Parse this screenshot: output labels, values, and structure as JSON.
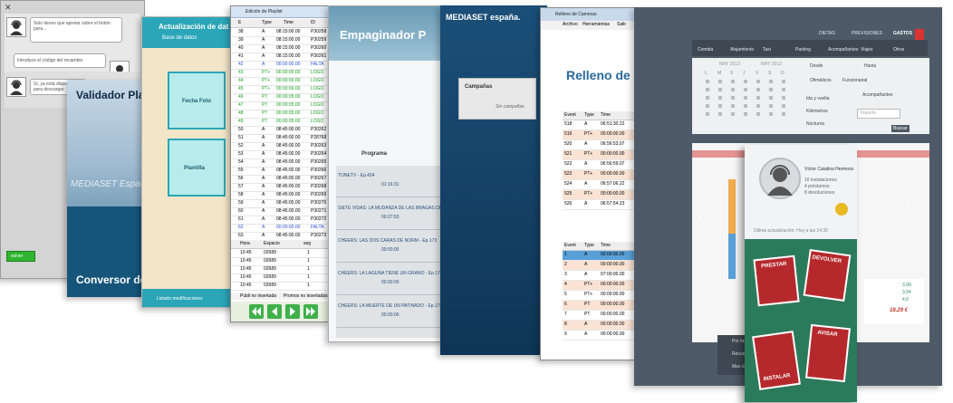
{
  "card1": {
    "close": "✕",
    "bubble1": "Solo tienes que apretar sobre el botón para...",
    "bubble2": "Introduce el código del recambio",
    "bubble3": "Sí, ya está disponible para descargar",
    "button": "volver"
  },
  "card2": {
    "title": "Validador Pla",
    "brand": "MEDIASET España",
    "footer": "Conversor de"
  },
  "card3": {
    "title": "Actualización de dat",
    "subtitle": "Base de datos",
    "tile1": "Fecha Foto",
    "tile2": "Plantilla",
    "footer": "Listado modificaciones"
  },
  "card4": {
    "window_title": "Edición de Playlist",
    "columns": [
      "E",
      "Type",
      "Time",
      "ID"
    ],
    "rows": [
      {
        "n": "38",
        "t": "A",
        "time": "08:15:00.00",
        "id": "P30258",
        "c": "#000000"
      },
      {
        "n": "39",
        "t": "A",
        "time": "08:15:00.00",
        "id": "P30259",
        "c": "#000000"
      },
      {
        "n": "40",
        "t": "A",
        "time": "08:15:00.00",
        "id": "P30260",
        "c": "#000000"
      },
      {
        "n": "41",
        "t": "A",
        "time": "08:15:00.00",
        "id": "P30261",
        "c": "#000000"
      },
      {
        "n": "42",
        "t": "A",
        "time": "00:00:00.00",
        "id": "FALTA",
        "c": "#2a4fd6"
      },
      {
        "n": "43",
        "t": "PT+",
        "time": "00:00:00.00",
        "id": "LOGO",
        "c": "#19a020"
      },
      {
        "n": "44",
        "t": "PT+",
        "time": "00:00:00.00",
        "id": "LOGO",
        "c": "#19a020"
      },
      {
        "n": "45",
        "t": "PT+",
        "time": "00:00:00.00",
        "id": "LOGO",
        "c": "#19a020"
      },
      {
        "n": "46",
        "t": "PT",
        "time": "00:00:05.00",
        "id": "LOGO",
        "c": "#19a020"
      },
      {
        "n": "47",
        "t": "PT",
        "time": "00:00:05.00",
        "id": "LOGO",
        "c": "#19a020"
      },
      {
        "n": "48",
        "t": "PT",
        "time": "00:00:05.00",
        "id": "LOGO",
        "c": "#19a020"
      },
      {
        "n": "49",
        "t": "PT",
        "time": "00:00:05.00",
        "id": "LOGO",
        "c": "#19a020"
      },
      {
        "n": "50",
        "t": "A",
        "time": "08:45:00.00",
        "id": "P30262",
        "c": "#000000"
      },
      {
        "n": "51",
        "t": "A",
        "time": "08:45:00.00",
        "id": "P28768",
        "c": "#000000"
      },
      {
        "n": "52",
        "t": "A",
        "time": "08:45:00.00",
        "id": "P30263",
        "c": "#000000"
      },
      {
        "n": "53",
        "t": "A",
        "time": "08:45:00.00",
        "id": "P30264",
        "c": "#000000"
      },
      {
        "n": "54",
        "t": "A",
        "time": "08:45:00.00",
        "id": "P30265",
        "c": "#000000"
      },
      {
        "n": "55",
        "t": "A",
        "time": "08:45:00.00",
        "id": "P30266",
        "c": "#000000"
      },
      {
        "n": "56",
        "t": "A",
        "time": "08:45:00.00",
        "id": "P30267",
        "c": "#000000"
      },
      {
        "n": "57",
        "t": "A",
        "time": "08:45:00.00",
        "id": "P30268",
        "c": "#000000"
      },
      {
        "n": "58",
        "t": "A",
        "time": "08:45:00.00",
        "id": "P30269",
        "c": "#000000"
      },
      {
        "n": "59",
        "t": "A",
        "time": "08:45:00.00",
        "id": "P30270",
        "c": "#000000"
      },
      {
        "n": "60",
        "t": "A",
        "time": "08:45:00.00",
        "id": "P30271",
        "c": "#000000"
      },
      {
        "n": "61",
        "t": "A",
        "time": "08:45:00.00",
        "id": "P30272",
        "c": "#000000"
      },
      {
        "n": "62",
        "t": "A",
        "time": "00:00:00.00",
        "id": "FALTA",
        "c": "#2a4fd6"
      },
      {
        "n": "63",
        "t": "A",
        "time": "08:45:00.00",
        "id": "P30273",
        "c": "#000000"
      }
    ],
    "sub_columns": [
      "Hora",
      "Espacio",
      "seg"
    ],
    "sub_rows": [
      {
        "h": "10:45",
        "e": "02689",
        "s": "1"
      },
      {
        "h": "10:45",
        "e": "02689",
        "s": "1"
      },
      {
        "h": "10:45",
        "e": "02689",
        "s": "1"
      },
      {
        "h": "10:45",
        "e": "02689",
        "s": "1"
      },
      {
        "h": "10:45",
        "e": "02689",
        "s": "1"
      }
    ],
    "tab1": "Publi no insertada",
    "tab2": "Promos no insertadas"
  },
  "card5": {
    "title": "Empaginador P",
    "section": "Programa",
    "items": [
      {
        "title": "TONETV - Ep.434",
        "time": "01:16:31"
      },
      {
        "title": "SIETE VIDAS: LA MUDANZA DE LAS BRAGAS DE O - Ep.37",
        "time": "00:27:53"
      },
      {
        "title": "CHEERS: LAS DOS CARAS DE NORM - Ep.173",
        "time": "00:00:00"
      },
      {
        "title": "CHEERS: LA LAGUNA TIENE UN GRANO - Ep.174",
        "time": "00:00:00"
      },
      {
        "title": "CHEERS: LA MUERTE DE UN PATINADO - Ep.175",
        "time": "00:00:00"
      }
    ]
  },
  "card6": {
    "brand": "MEDIASET españa.",
    "panel_label": "Campañas",
    "panel_value": "Sin campañas"
  },
  "card7": {
    "window_title": "Relleno de Cameras",
    "menu": [
      "Archivo",
      "Herramientas",
      "Salir"
    ],
    "title": "Relleno de C",
    "columns": [
      "Event",
      "Type",
      "Time"
    ],
    "rows": [
      {
        "e": "518",
        "t": "A",
        "time": "06:51:30.22"
      },
      {
        "e": "519",
        "t": "PT+",
        "time": "00:00:00.00"
      },
      {
        "e": "520",
        "t": "A",
        "time": "06:56:53.07"
      },
      {
        "e": "521",
        "t": "PT+",
        "time": "00:00:00.00"
      },
      {
        "e": "522",
        "t": "A",
        "time": "06:56:59.07"
      },
      {
        "e": "523",
        "t": "PT+",
        "time": "00:00:00.00"
      },
      {
        "e": "524",
        "t": "A",
        "time": "06:57:06.22"
      },
      {
        "e": "525",
        "t": "PT+",
        "time": "00:00:00.00"
      },
      {
        "e": "526",
        "t": "A",
        "time": "06:57:54.23"
      }
    ],
    "columns2": [
      "Event",
      "Type",
      "Time"
    ],
    "rows2": [
      {
        "e": "1",
        "t": "A",
        "time": "00:00:00.00"
      },
      {
        "e": "2",
        "t": "A",
        "time": "00:00:00.00"
      },
      {
        "e": "3",
        "t": "A",
        "time": "07:00:00.00"
      },
      {
        "e": "4",
        "t": "PT+",
        "time": "00:00:00.00"
      },
      {
        "e": "5",
        "t": "PT+",
        "time": "00:00:00.00"
      },
      {
        "e": "6",
        "t": "PT",
        "time": "00:00:00.00"
      },
      {
        "e": "7",
        "t": "PT",
        "time": "00:00:00.00"
      },
      {
        "e": "8",
        "t": "A",
        "time": "00:00:00.00"
      },
      {
        "e": "9",
        "t": "A",
        "time": "00:00:00.00"
      }
    ]
  },
  "card8": {
    "top_links": [
      "DIETAS",
      "PREVISIONES",
      "GASTOS"
    ],
    "nav": [
      "Comida",
      "Alojamiento",
      "Taxi",
      "Parking",
      "Acompañantes",
      "Viajes",
      "Otros"
    ],
    "month1": "MAY 2013",
    "month2": "MAY 2013",
    "weekdays": [
      "L",
      "M",
      "X",
      "J",
      "V",
      "S",
      "D"
    ],
    "label_desde": "Desde",
    "label_hasta": "Hasta",
    "opt1": "Ofimáticos",
    "opt2": "Funcionarial",
    "opt3": "Ida y vuelta",
    "opt4": "Kilómetros",
    "opt5": "Nocturno",
    "acompanantes": "Acompañantes",
    "importe_placeholder": "Importe",
    "search_btn": "Buscar",
    "tab_comida": "Comida",
    "tab_viaje": "Viaje a ayudar",
    "summary": [
      "3,90",
      "3,94",
      "4,6"
    ],
    "total": "18,29 €",
    "footer": [
      "Por fav",
      "Recuer",
      "Mas d"
    ]
  },
  "card9": {
    "name": "Víctor Catalina Hermoso",
    "stats": [
      "16 instalaciones",
      "4 préstamos",
      "8 devoluciones"
    ],
    "update": "Última actualización: Hoy a las 14:30",
    "prestar": "PRESTAR",
    "devolver": "DEVOLVER",
    "avisar": "AVISAR",
    "instalar": "INSTALAR"
  },
  "colors": {
    "teal": "#1e7c93",
    "navy": "#1d3f66",
    "slate": "#4e5a67",
    "green": "#2a8a5d",
    "red": "#b23a3a",
    "blue_title": "#2a6a9c"
  }
}
